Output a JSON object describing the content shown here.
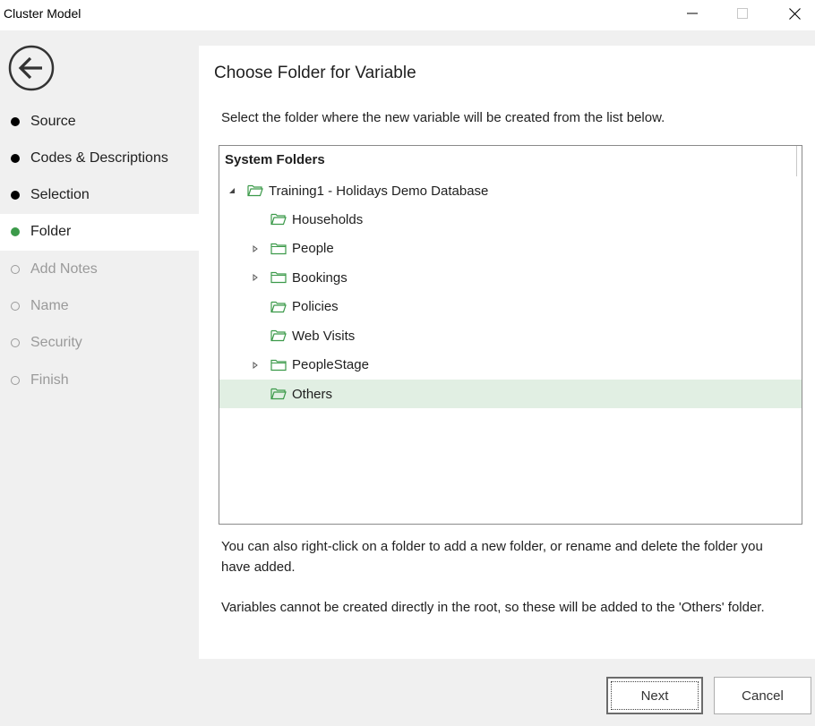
{
  "window": {
    "title": "Cluster Model"
  },
  "sidebar": {
    "steps": [
      {
        "label": "Source",
        "state": "done"
      },
      {
        "label": "Codes & Descriptions",
        "state": "done"
      },
      {
        "label": "Selection",
        "state": "done"
      },
      {
        "label": "Folder",
        "state": "current"
      },
      {
        "label": "Add Notes",
        "state": "todo"
      },
      {
        "label": "Name",
        "state": "todo"
      },
      {
        "label": "Security",
        "state": "todo"
      },
      {
        "label": "Finish",
        "state": "todo"
      }
    ]
  },
  "main": {
    "heading": "Choose Folder for Variable",
    "instruction": "Select the folder where the new variable will be created from the list below.",
    "tree": {
      "header": "System Folders",
      "root": {
        "label": "Training1 - Holidays Demo Database",
        "expanded": true
      },
      "children": [
        {
          "label": "Households",
          "expandable": false,
          "open": true
        },
        {
          "label": "People",
          "expandable": true,
          "open": false
        },
        {
          "label": "Bookings",
          "expandable": true,
          "open": false
        },
        {
          "label": "Policies",
          "expandable": false,
          "open": true
        },
        {
          "label": "Web Visits",
          "expandable": false,
          "open": true
        },
        {
          "label": "PeopleStage",
          "expandable": true,
          "open": false
        },
        {
          "label": "Others",
          "expandable": false,
          "open": true,
          "selected": true
        }
      ]
    },
    "note1": "You can also right-click on a folder to add a new folder, or rename and delete the folder you have added.",
    "note2": "Variables cannot be created directly in the root, so these will be added to the 'Others' folder."
  },
  "footer": {
    "next_label": "Next",
    "cancel_label": "Cancel"
  },
  "colors": {
    "accent_green": "#3c9a4a",
    "selection_bg": "#e1efe3"
  }
}
